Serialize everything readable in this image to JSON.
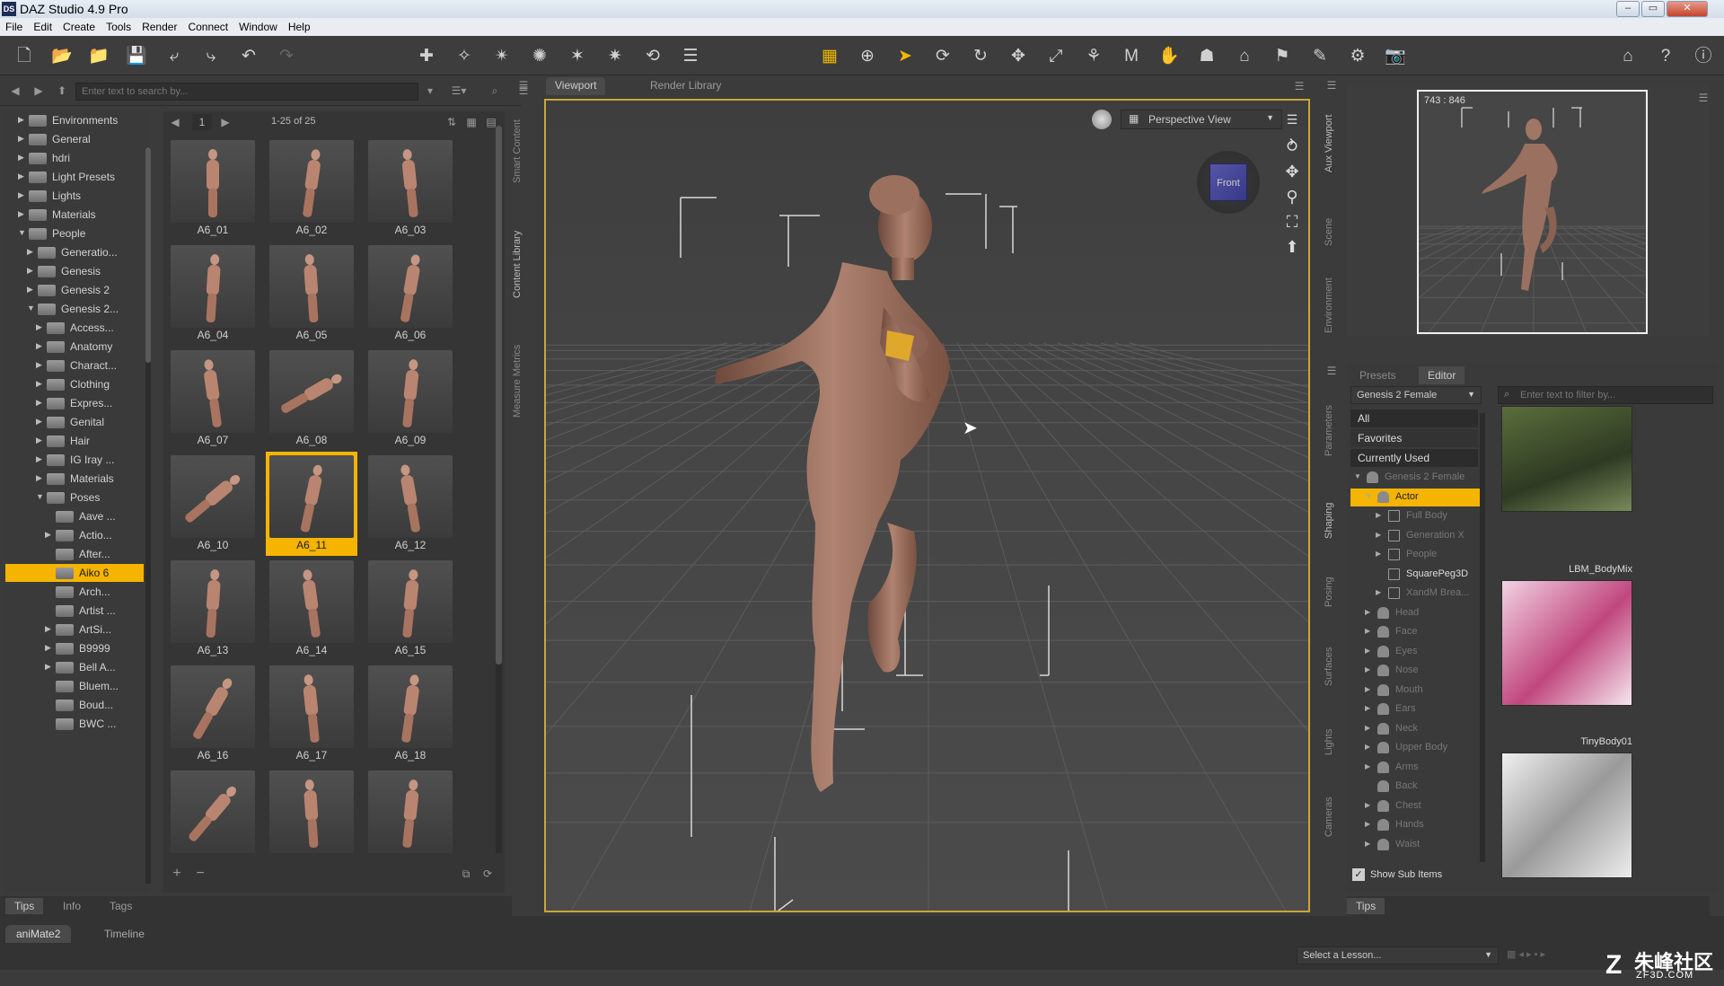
{
  "title": "DAZ Studio 4.9 Pro",
  "app_logo": "DS",
  "window_buttons": {
    "minimize": "–",
    "restore": "▭",
    "close": "✕"
  },
  "menu": [
    "File",
    "Edit",
    "Create",
    "Tools",
    "Render",
    "Connect",
    "Window",
    "Help"
  ],
  "library": {
    "search_placeholder": "Enter text to search by...",
    "page_number": "1",
    "range": "1-25 of 25",
    "tree": [
      {
        "label": "Environments",
        "depth": 0,
        "state": "collapsed"
      },
      {
        "label": "General",
        "depth": 0,
        "state": "collapsed"
      },
      {
        "label": "hdri",
        "depth": 0,
        "state": "collapsed"
      },
      {
        "label": "Light Presets",
        "depth": 0,
        "state": "collapsed"
      },
      {
        "label": "Lights",
        "depth": 0,
        "state": "collapsed"
      },
      {
        "label": "Materials",
        "depth": 0,
        "state": "collapsed"
      },
      {
        "label": "People",
        "depth": 0,
        "state": "expanded"
      },
      {
        "label": "Generatio...",
        "depth": 1,
        "state": "collapsed"
      },
      {
        "label": "Genesis",
        "depth": 1,
        "state": "collapsed"
      },
      {
        "label": "Genesis 2",
        "depth": 1,
        "state": "collapsed"
      },
      {
        "label": "Genesis 2...",
        "depth": 1,
        "state": "expanded"
      },
      {
        "label": "Access...",
        "depth": 2,
        "state": "collapsed"
      },
      {
        "label": "Anatomy",
        "depth": 2,
        "state": "collapsed"
      },
      {
        "label": "Charact...",
        "depth": 2,
        "state": "collapsed"
      },
      {
        "label": "Clothing",
        "depth": 2,
        "state": "collapsed"
      },
      {
        "label": "Expres...",
        "depth": 2,
        "state": "collapsed"
      },
      {
        "label": "Genital",
        "depth": 2,
        "state": "collapsed"
      },
      {
        "label": "Hair",
        "depth": 2,
        "state": "collapsed"
      },
      {
        "label": "IG Iray ...",
        "depth": 2,
        "state": "collapsed"
      },
      {
        "label": "Materials",
        "depth": 2,
        "state": "collapsed"
      },
      {
        "label": "Poses",
        "depth": 2,
        "state": "expanded"
      },
      {
        "label": "Aave ...",
        "depth": 3,
        "state": "leaf"
      },
      {
        "label": "Actio...",
        "depth": 3,
        "state": "collapsed"
      },
      {
        "label": "After...",
        "depth": 3,
        "state": "leaf"
      },
      {
        "label": "Aiko 6",
        "depth": 3,
        "state": "selected"
      },
      {
        "label": "Arch...",
        "depth": 3,
        "state": "leaf"
      },
      {
        "label": "Artist ...",
        "depth": 3,
        "state": "leaf"
      },
      {
        "label": "ArtSi...",
        "depth": 3,
        "state": "collapsed"
      },
      {
        "label": "B9999",
        "depth": 3,
        "state": "collapsed"
      },
      {
        "label": "Bell A...",
        "depth": 3,
        "state": "collapsed"
      },
      {
        "label": "Bluem...",
        "depth": 3,
        "state": "leaf"
      },
      {
        "label": "Boud...",
        "depth": 3,
        "state": "leaf"
      },
      {
        "label": "BWC ...",
        "depth": 3,
        "state": "leaf"
      }
    ],
    "thumbnails": [
      "A6_01",
      "A6_02",
      "A6_03",
      "A6_04",
      "A6_05",
      "A6_06",
      "A6_07",
      "A6_08",
      "A6_09",
      "A6_10",
      "A6_11",
      "A6_12",
      "A6_13",
      "A6_14",
      "A6_15",
      "A6_16",
      "A6_17",
      "A6_18",
      "",
      "",
      ""
    ],
    "selected_thumbnail": "A6_11",
    "bottom_tabs": [
      "Tips",
      "Info",
      "Tags"
    ],
    "vertical_tabs": [
      "Smart Content",
      "Content Library",
      "Measure Metrics"
    ]
  },
  "viewport": {
    "tabs": [
      "Viewport",
      "Render Library"
    ],
    "active_tab": "Viewport",
    "camera": "Perspective View",
    "cube_label": "Front"
  },
  "aux": {
    "vertical_tabs": [
      "Aux Viewport",
      "Scene",
      "Environment"
    ],
    "resolution": "743 : 846"
  },
  "parameters": {
    "tabs": [
      "Presets",
      "Editor"
    ],
    "active_tab": "Editor",
    "figure": "Genesis 2 Female",
    "filter_placeholder": "Enter text to filter by...",
    "quick": [
      "All",
      "Favorites",
      "Currently Used"
    ],
    "tree": [
      {
        "label": "Genesis 2 Female",
        "depth": 0,
        "icon": "figure",
        "state": "expanded",
        "dim": true
      },
      {
        "label": "Actor",
        "depth": 1,
        "icon": "figure",
        "state": "selected",
        "dim": false
      },
      {
        "label": "Full Body",
        "depth": 2,
        "icon": "group",
        "state": "collapsed",
        "dim": true
      },
      {
        "label": "Generation X",
        "depth": 2,
        "icon": "group",
        "state": "collapsed",
        "dim": true
      },
      {
        "label": "People",
        "depth": 2,
        "icon": "group",
        "state": "collapsed",
        "dim": true
      },
      {
        "label": "SquarePeg3D",
        "depth": 2,
        "icon": "group",
        "state": "leaf",
        "dim": false
      },
      {
        "label": "XandM Brea...",
        "depth": 2,
        "icon": "group",
        "state": "collapsed",
        "dim": true
      },
      {
        "label": "Head",
        "depth": 1,
        "icon": "figure",
        "state": "collapsed",
        "dim": true
      },
      {
        "label": "Face",
        "depth": 1,
        "icon": "figure",
        "state": "collapsed",
        "dim": true
      },
      {
        "label": "Eyes",
        "depth": 1,
        "icon": "figure",
        "state": "collapsed",
        "dim": true
      },
      {
        "label": "Nose",
        "depth": 1,
        "icon": "figure",
        "state": "collapsed",
        "dim": true
      },
      {
        "label": "Mouth",
        "depth": 1,
        "icon": "figure",
        "state": "collapsed",
        "dim": true
      },
      {
        "label": "Ears",
        "depth": 1,
        "icon": "figure",
        "state": "collapsed",
        "dim": true
      },
      {
        "label": "Neck",
        "depth": 1,
        "icon": "figure",
        "state": "collapsed",
        "dim": true
      },
      {
        "label": "Upper Body",
        "depth": 1,
        "icon": "figure",
        "state": "collapsed",
        "dim": true
      },
      {
        "label": "Arms",
        "depth": 1,
        "icon": "figure",
        "state": "collapsed",
        "dim": true
      },
      {
        "label": "Back",
        "depth": 1,
        "icon": "figure",
        "state": "leaf",
        "dim": true
      },
      {
        "label": "Chest",
        "depth": 1,
        "icon": "figure",
        "state": "collapsed",
        "dim": true
      },
      {
        "label": "Hands",
        "depth": 1,
        "icon": "figure",
        "state": "collapsed",
        "dim": true
      },
      {
        "label": "Waist",
        "depth": 1,
        "icon": "figure",
        "state": "collapsed",
        "dim": true
      }
    ],
    "show_sub_items": "Show Sub Items",
    "swatches": [
      "",
      "LBM_BodyMix",
      "TinyBody01"
    ],
    "vertical_tabs": [
      "Parameters",
      "Shaping",
      "Posing",
      "Surfaces",
      "Lights",
      "Cameras"
    ],
    "bottom_tab": "Tips"
  },
  "statusbar": {
    "tabs": [
      "aniMate2",
      "Timeline"
    ],
    "lesson_placeholder": "Select a Lesson...",
    "watermark_text": "朱峰社区",
    "watermark_sub": "ZF3D.COM"
  },
  "colors": {
    "selection": "#f4b400",
    "viewport_border": "#c9a63a",
    "background": "#3b3b3b"
  }
}
